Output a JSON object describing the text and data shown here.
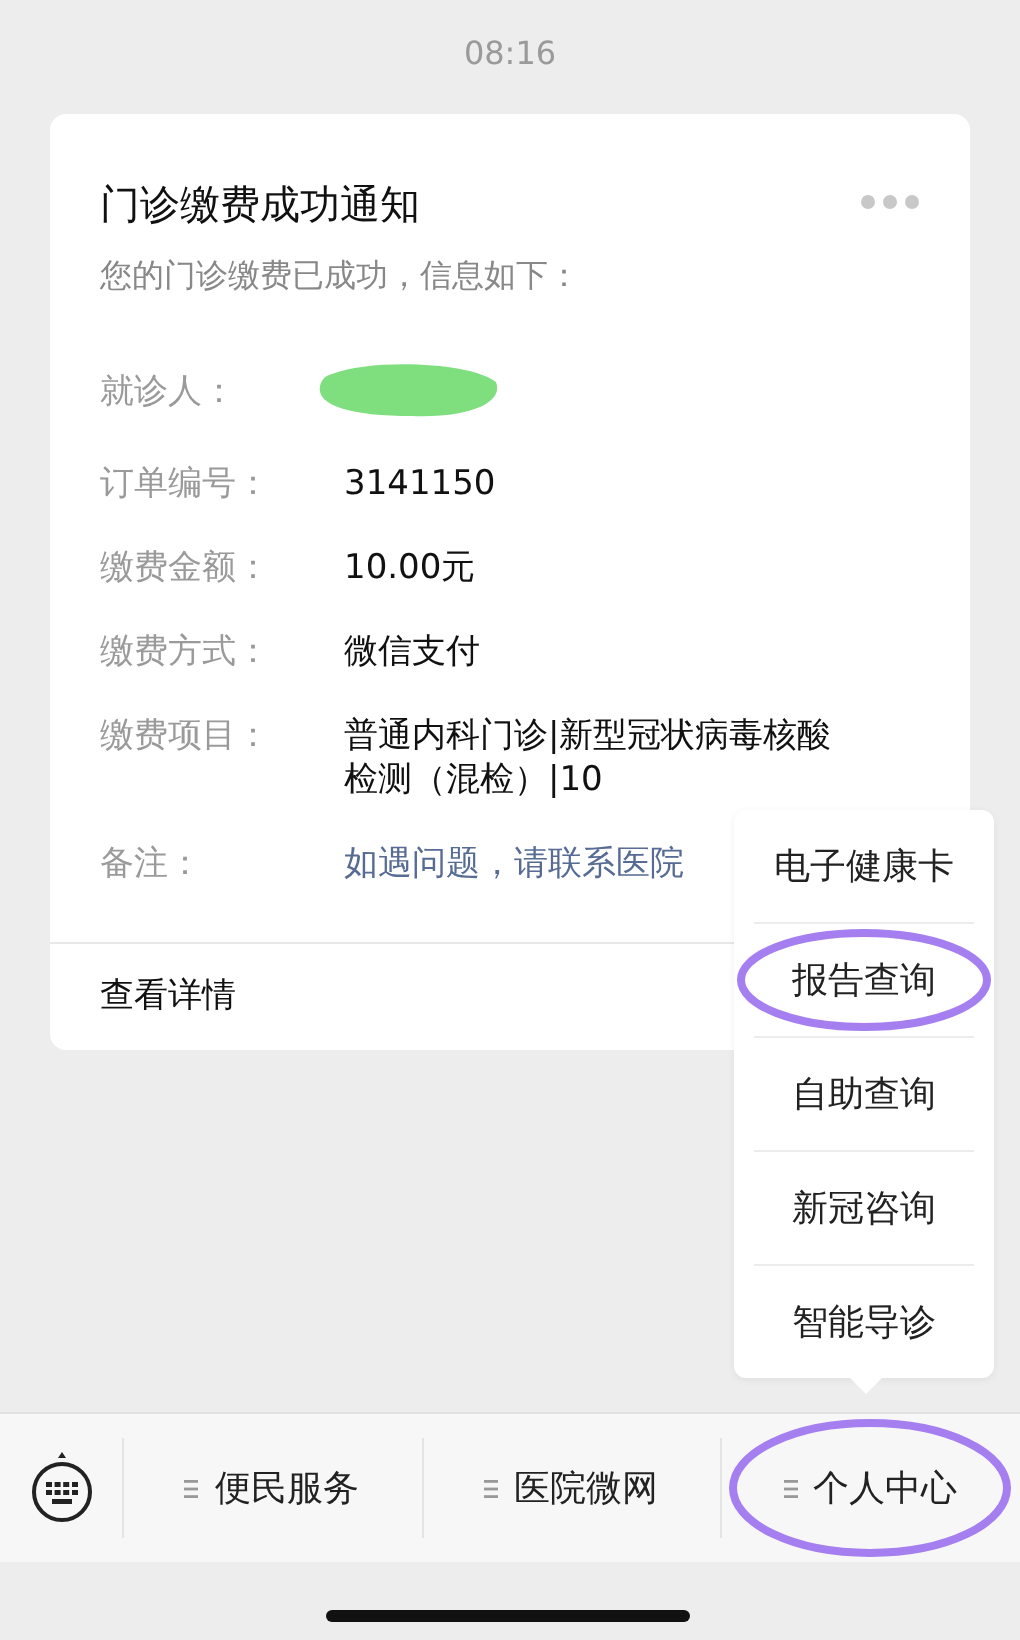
{
  "time": "08:16",
  "card": {
    "title": "门诊缴费成功通知",
    "subtitle": "您的门诊缴费已成功，信息如下：",
    "rows": [
      {
        "label": "就诊人：",
        "kind": "redacted"
      },
      {
        "label": "订单编号：",
        "kind": "text",
        "value": "3141150"
      },
      {
        "label": "缴费金额：",
        "kind": "text",
        "value": "10.00元"
      },
      {
        "label": "缴费方式：",
        "kind": "text",
        "value": "微信支付"
      },
      {
        "label": "缴费项目：",
        "kind": "text",
        "value": "普通内科门诊|新型冠状病毒核酸检测（混检）|10"
      },
      {
        "label": "备注：",
        "kind": "link",
        "value": "如遇问题，请联系医院"
      }
    ],
    "footer": "查看详情"
  },
  "popup_menu": [
    {
      "label": "电子健康卡",
      "highlighted": false
    },
    {
      "label": "报告查询",
      "highlighted": true
    },
    {
      "label": "自助查询",
      "highlighted": false
    },
    {
      "label": "新冠咨询",
      "highlighted": false
    },
    {
      "label": "智能导诊",
      "highlighted": false
    }
  ],
  "menu_bar": [
    {
      "label": "便民服务",
      "highlighted": false
    },
    {
      "label": "医院微网",
      "highlighted": false
    },
    {
      "label": "个人中心",
      "highlighted": true
    }
  ]
}
